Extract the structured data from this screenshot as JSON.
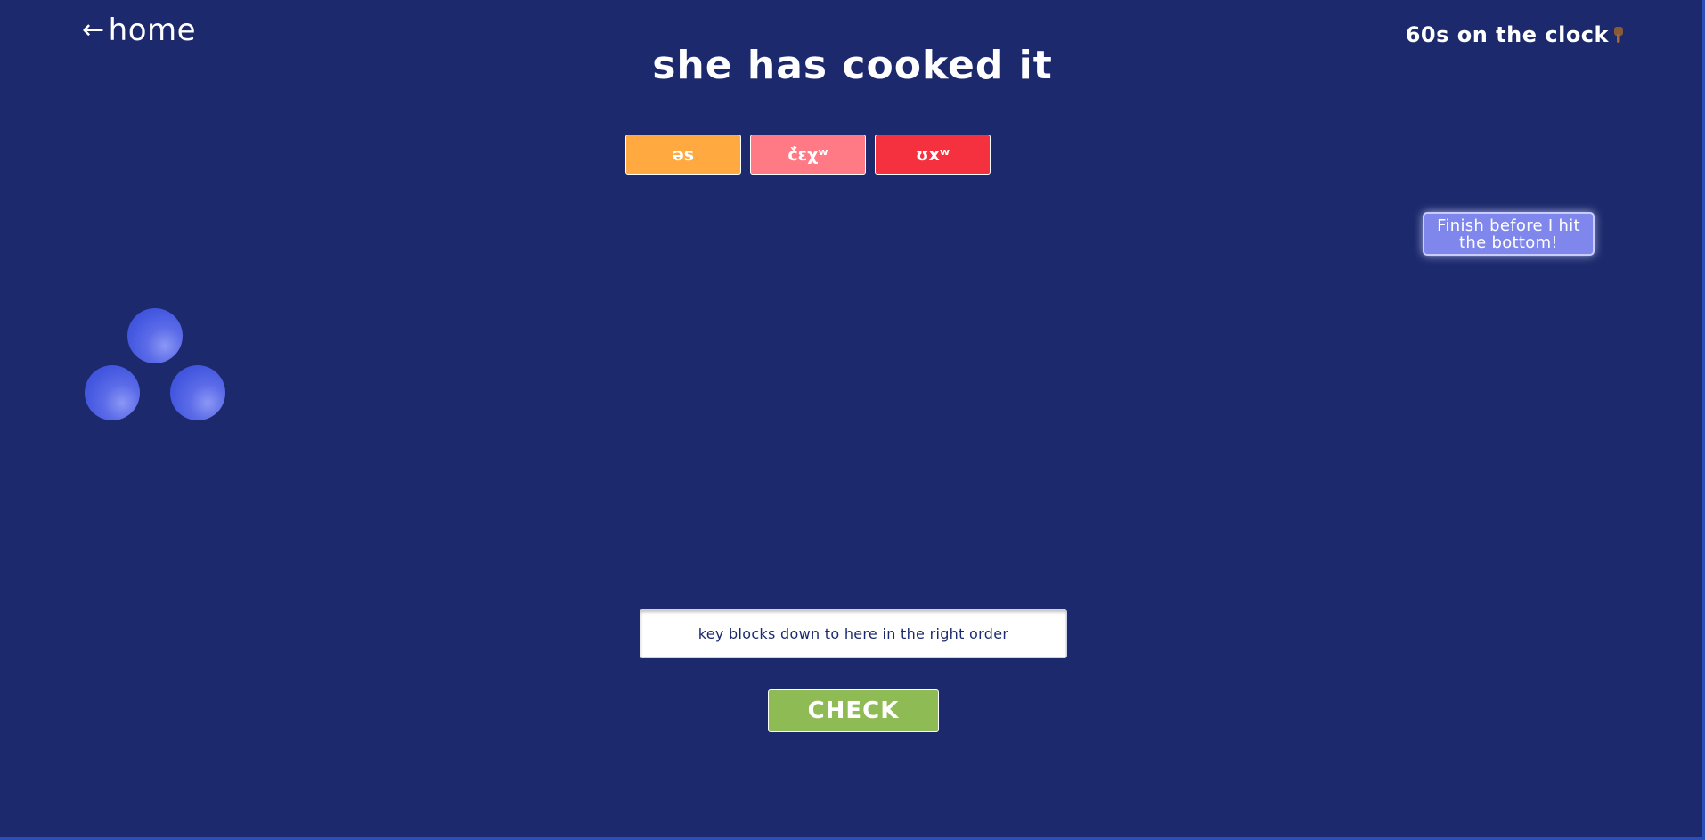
{
  "nav": {
    "home_label": "home",
    "back_icon": "arrow-left-icon"
  },
  "timer": {
    "label": "60s on the clock",
    "icon": "pointing-down-hand-icon"
  },
  "prompt": "she has cooked it",
  "blocks": [
    {
      "label": "əs",
      "color": "#ffa940"
    },
    {
      "label": "č̓ɛχʷ",
      "color": "#ff7a85"
    },
    {
      "label": "ʊxʷ",
      "color": "#f5303f"
    }
  ],
  "tooltip": "Finish before I hit the bottom!",
  "drop_zone": {
    "placeholder": "key blocks down to here in the right order"
  },
  "check_label": "CHECK",
  "colors": {
    "background": "#1c2a6d",
    "ball": "#4a5ce3",
    "check": "#8fbb54"
  }
}
